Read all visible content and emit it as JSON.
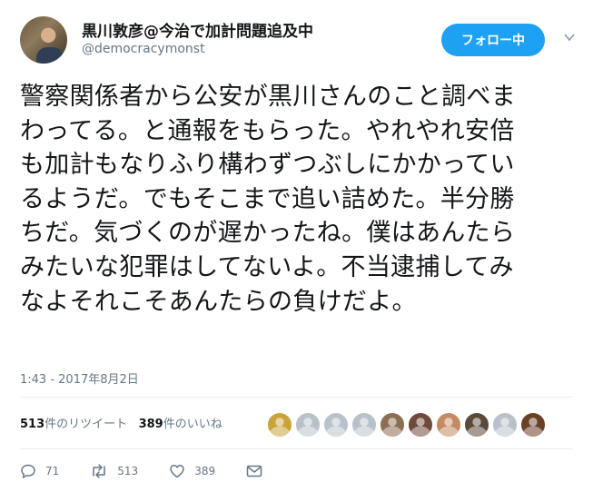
{
  "user": {
    "display_name": "黒川敦彦@今治で加計問題追及中",
    "handle": "@democracymonst",
    "follow_label": "フォロー中"
  },
  "tweet": {
    "lines": [
      "警察関係者から公安が黒川さんのこと調べま",
      "わってる。と通報をもらった。やれやれ安倍",
      "も加計もなりふり構わずつぶしにかかってい",
      "るようだ。でもそこまで追い詰めた。半分勝",
      "ちだ。気づくのが遅かったね。僕はあんたら",
      "みたいな犯罪はしてないよ。不当逮捕してみ",
      "なよそれこそあんたらの負けだよ。"
    ],
    "timestamp": "1:43 - 2017年8月2日"
  },
  "stats": {
    "retweets_count": "513",
    "retweets_label": "件のリツイート",
    "likes_count": "389",
    "likes_label": "件のいいね"
  },
  "likers": {
    "colors": [
      "#c9a43a",
      "#b9c2cb",
      "#b9c2cb",
      "#b9c2cb",
      "#8c6e52",
      "#6e4a3a",
      "#c48a62",
      "#5a4a3c",
      "#b9c2cb",
      "#6a4028"
    ]
  },
  "actions": {
    "reply_count": "71",
    "retweet_count": "513",
    "like_count": "389"
  },
  "colors": {
    "accent": "#1da1f2",
    "secondary_text": "#657786"
  },
  "icons": [
    "chevron-down-icon",
    "reply-icon",
    "retweet-icon",
    "like-icon",
    "message-icon"
  ]
}
